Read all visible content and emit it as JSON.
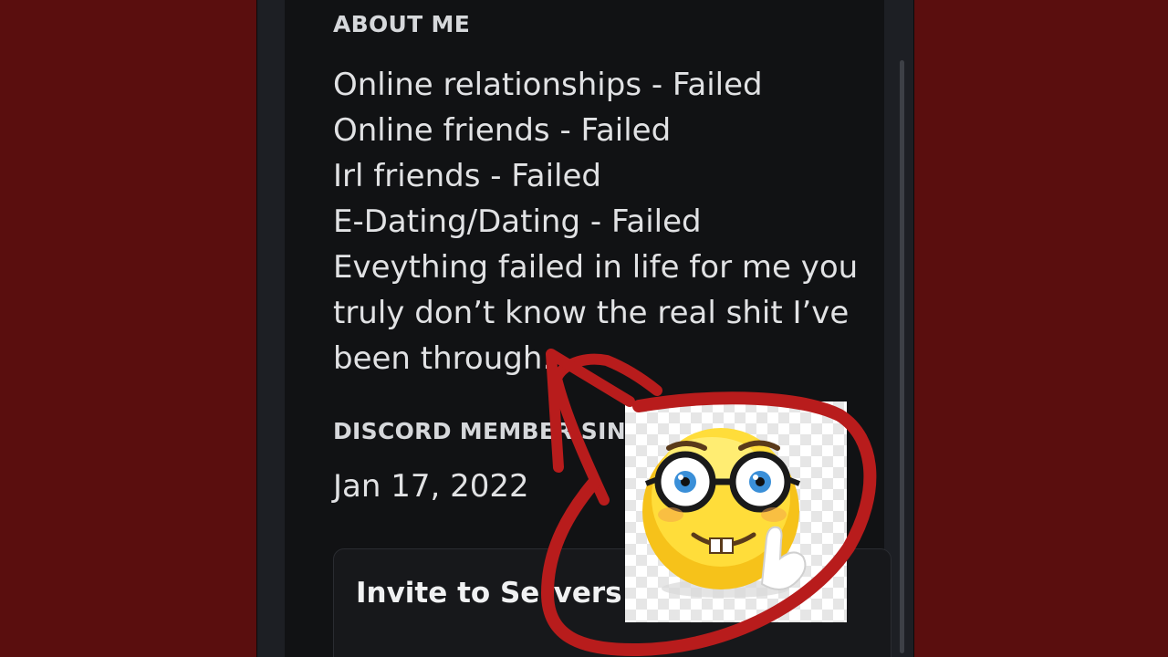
{
  "profile": {
    "about_title": "ABOUT ME",
    "about_lines": [
      "Online relationships - Failed",
      "Online friends - Failed",
      "Irl friends - Failed",
      "E-Dating/Dating - Failed",
      "Eveything failed in life for me you",
      "truly don’t know the real shit I’ve",
      "been through."
    ],
    "member_since_title": "DISCORD MEMBER SINCE",
    "member_since_date": "Jan 17, 2022",
    "invite_button_label": "Invite to Servers"
  },
  "overlay": {
    "emoji_icon": "nerd-face-emoji-icon",
    "annotation_color": "#b81c1c",
    "background_color": "#5a0e0e"
  }
}
